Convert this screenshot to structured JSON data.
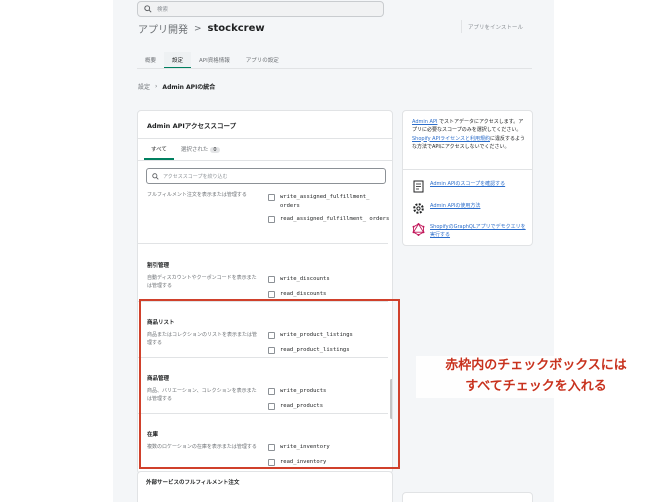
{
  "top_search": {
    "placeholder": "検索"
  },
  "header": {
    "breadcrumb_parent": "アプリ開発",
    "separator": ">",
    "app_name": "stockcrew",
    "install_button": "アプリをインストール"
  },
  "tabs": [
    {
      "label": "概要"
    },
    {
      "label": "設定"
    },
    {
      "label": "API資格情報"
    },
    {
      "label": "アプリの設定"
    }
  ],
  "breadcrumb": {
    "parent": "設定",
    "current": "Admin APIの統合"
  },
  "scopes_card": {
    "title": "Admin APIアクセススコープ",
    "filter_all": "すべて",
    "filter_selected": "選択された",
    "selected_count": "0",
    "search_placeholder": "アクセススコープを絞り込む",
    "top_desc": "フルフィルメント注文を表示または管理する",
    "top_scopes": [
      "write_assigned_fulfillment_ orders",
      "read_assigned_fulfillment_ orders"
    ],
    "sections": [
      {
        "title": "割引管理",
        "desc": "自動ディスカウントやクーポンコードを表示または管理する",
        "scopes": [
          "write_discounts",
          "read_discounts"
        ]
      },
      {
        "title": "商品リスト",
        "desc": "商品またはコレクションのリストを表示または管理する",
        "scopes": [
          "write_product_listings",
          "read_product_listings"
        ]
      },
      {
        "title": "商品管理",
        "desc": "商品、バリエーション、コレクションを表示または管理する",
        "scopes": [
          "write_products",
          "read_products"
        ]
      },
      {
        "title": "在庫",
        "desc": "複数のロケーションの在庫を表示または管理する",
        "scopes": [
          "write_inventory",
          "read_inventory"
        ]
      }
    ],
    "next_card_title": "外部サービスのフルフィルメント注文"
  },
  "side_card": {
    "intro_link": "Admin API",
    "intro_text": "でストアデータにアクセスします。アプリに必要なスコープのみを選択してください。",
    "license_link": "Shopify APIライセンスと利用規約",
    "license_text": "に違反するような方法でAPIにアクセスしないでください。",
    "links": [
      {
        "icon": "document-icon",
        "label": "Admin APIのスコープを確認する"
      },
      {
        "icon": "gear-icon",
        "label": "Admin APIの使用方法"
      },
      {
        "icon": "graphql-icon",
        "label": "ShopifyのGraphQLアプリでデモクエリを実行する"
      }
    ]
  },
  "annotation": {
    "line1": "赤枠内のチェックボックスには",
    "line2": "すべてチェックを入れる"
  },
  "colors": {
    "accent": "#008060",
    "link": "#2c6ecb",
    "annotation": "#c8321e",
    "frame": "#d0402b"
  }
}
